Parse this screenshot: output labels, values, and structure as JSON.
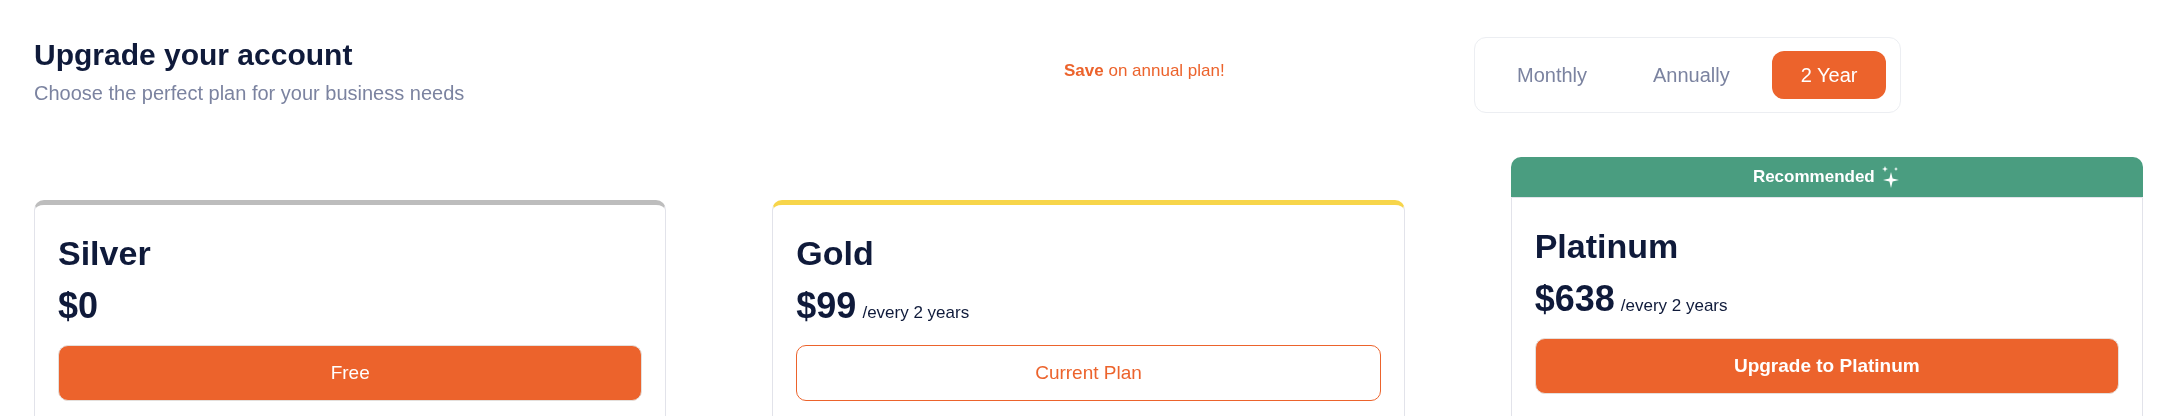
{
  "header": {
    "title": "Upgrade your account",
    "subtitle": "Choose the perfect plan for your business needs"
  },
  "promo": "**Save** on annual plan!",
  "billing_options": [
    {
      "label": "Monthly",
      "selected": false
    },
    {
      "label": "Annually",
      "selected": false
    },
    {
      "label": "2 Year",
      "selected": true
    }
  ],
  "plans": [
    {
      "name": "Silver",
      "price": "$0",
      "color": "#bdbdbd",
      "button": {
        "label": "Free",
        "kind": "filled"
      }
    },
    {
      "name": "Gold",
      "price": "$99",
      "period": "/every 2 years",
      "color": "#f7d54a",
      "button": {
        "label": "Current Plan",
        "kind": "outline"
      }
    },
    {
      "name": "Platinum",
      "price": "$638",
      "period": "/every 2 years",
      "color": "#4a9d80",
      "badge": "Recommended",
      "button": {
        "label": "Upgrade to Platinum",
        "kind": "filled"
      }
    }
  ]
}
